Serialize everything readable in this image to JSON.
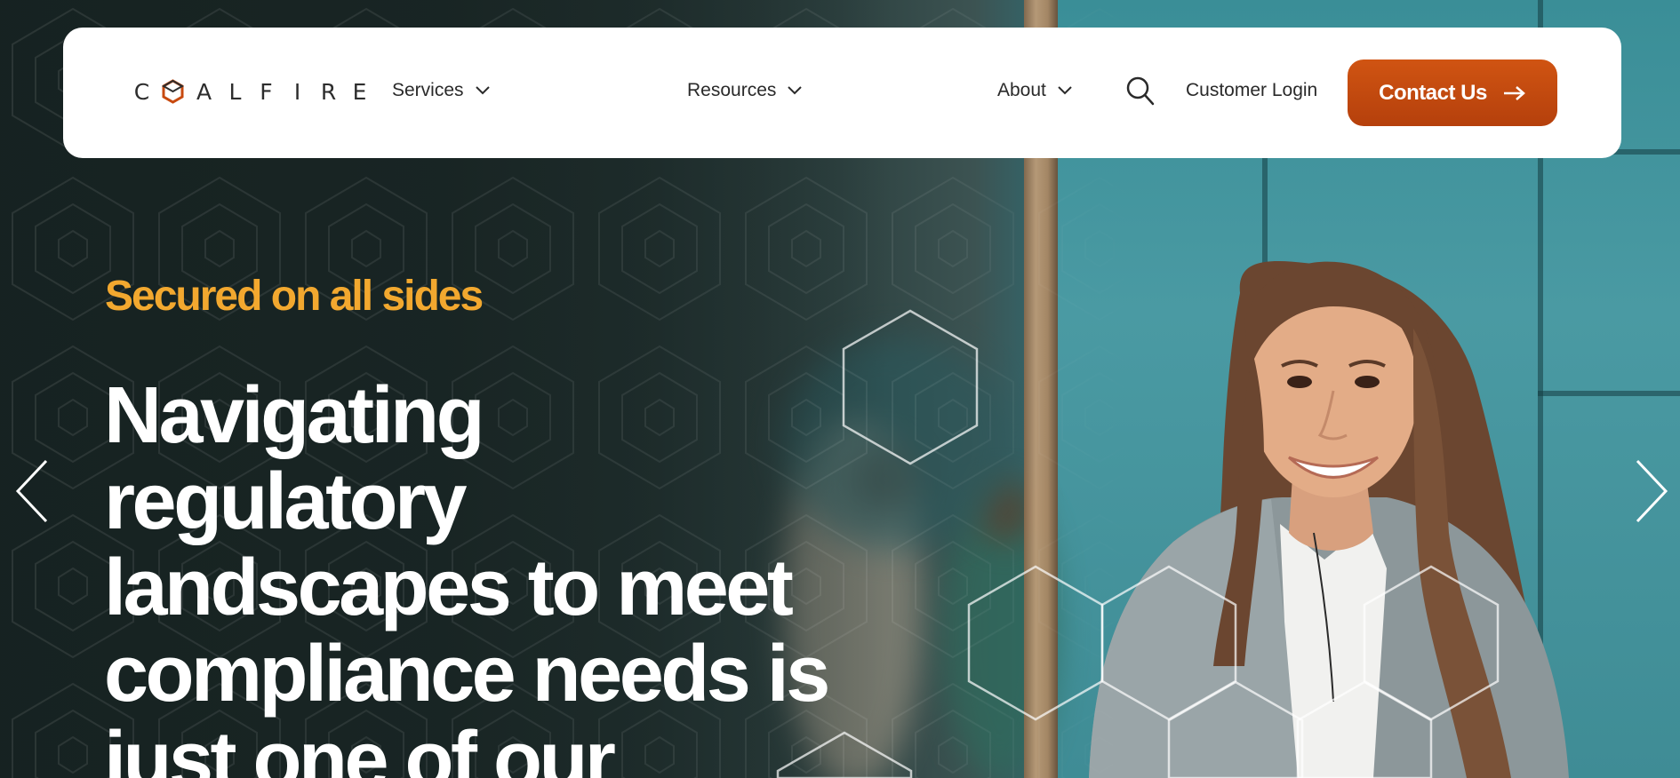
{
  "brand": {
    "letters": [
      "C",
      "A",
      "L",
      "F",
      "I",
      "R",
      "E"
    ],
    "logo_mark": "hexagon-o-mark",
    "accent_color": "#c84a0f"
  },
  "nav": {
    "items": [
      {
        "label": "Services",
        "icon": "chevron-down-icon"
      },
      {
        "label": "Resources",
        "icon": "chevron-down-icon"
      },
      {
        "label": "About",
        "icon": "chevron-down-icon"
      }
    ],
    "search_icon": "search-icon",
    "customer_login": "Customer Login",
    "contact_button": "Contact Us",
    "contact_icon": "arrow-right-icon"
  },
  "hero": {
    "eyebrow": "Secured on all sides",
    "eyebrow_color": "#f2a82f",
    "headline_lines": [
      "Navigating",
      "regulatory",
      "landscapes to meet",
      "compliance needs is",
      "just one of our"
    ]
  },
  "carousel": {
    "prev_icon": "chevron-left-icon",
    "next_icon": "chevron-right-icon"
  }
}
